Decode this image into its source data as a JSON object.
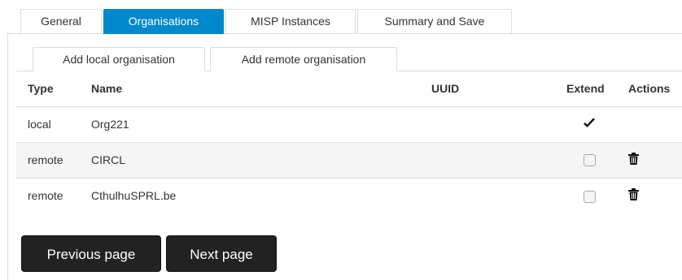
{
  "top_tabs": [
    {
      "label": "General",
      "active": false
    },
    {
      "label": "Organisations",
      "active": true
    },
    {
      "label": "MISP Instances",
      "active": false
    },
    {
      "label": "Summary and Save",
      "active": false
    }
  ],
  "sub_tabs": [
    {
      "label": "Add local organisation"
    },
    {
      "label": "Add remote organisation"
    }
  ],
  "table": {
    "headers": {
      "type": "Type",
      "name": "Name",
      "uuid": "UUID",
      "extend": "Extend",
      "actions": "Actions"
    },
    "rows": [
      {
        "type": "local",
        "name": "Org221",
        "uuid": "",
        "extend": "checkmark-icon",
        "actions": ""
      },
      {
        "type": "remote",
        "name": "CIRCL",
        "uuid": "",
        "extend": "checkbox-unchecked",
        "actions": "trash-icon"
      },
      {
        "type": "remote",
        "name": "CthulhuSPRL.be",
        "uuid": "",
        "extend": "checkbox-unchecked",
        "actions": "trash-icon"
      }
    ]
  },
  "buttons": {
    "previous": "Previous page",
    "next": "Next page"
  },
  "colors": {
    "active_tab": "#0088cc",
    "button": "#222222",
    "row_stripe": "#f5f5f5"
  }
}
